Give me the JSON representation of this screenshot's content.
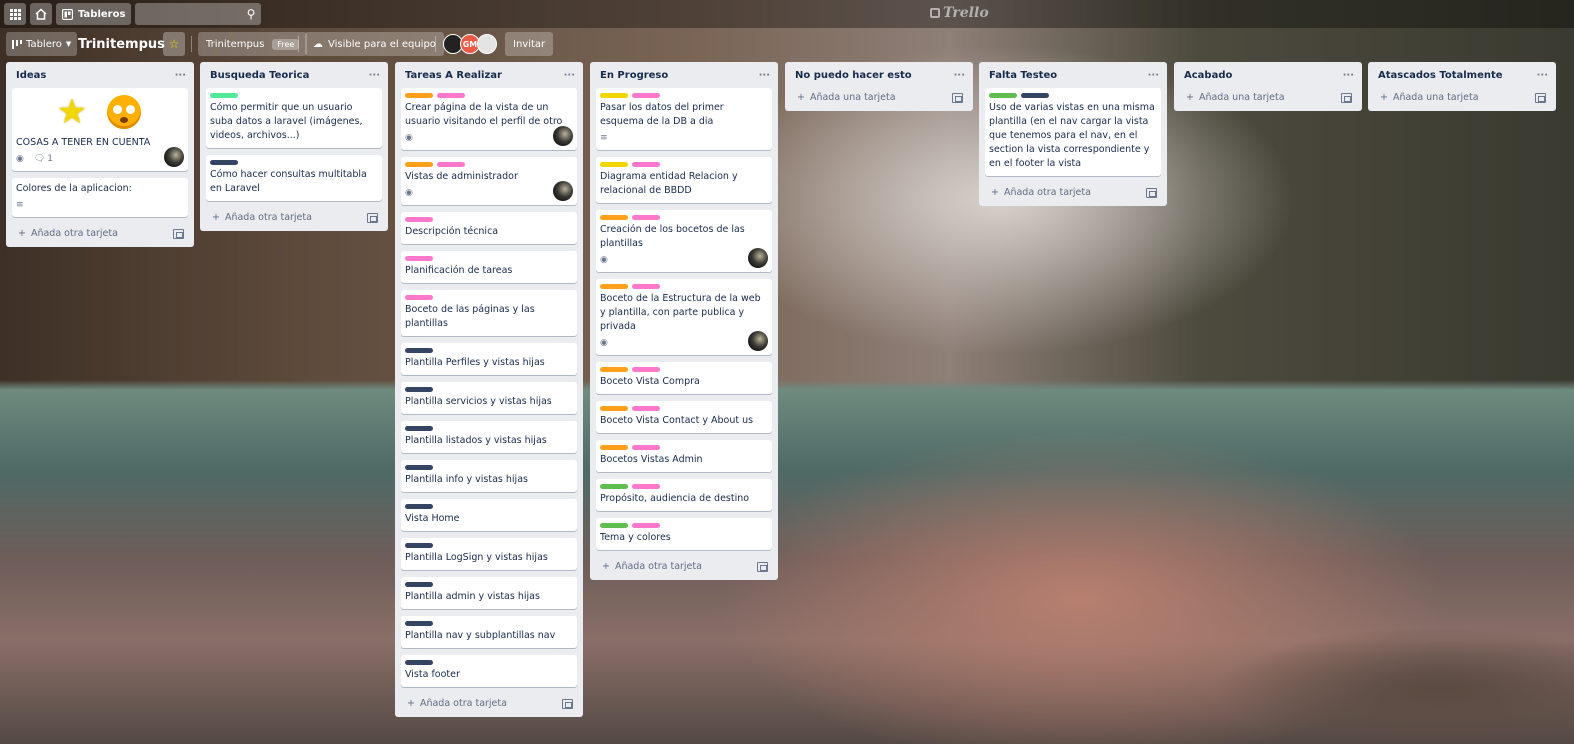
{
  "topbar": {
    "apps_icon": "grid-icon",
    "home_icon": "house-icon",
    "boards_label": "Tableros",
    "search_placeholder": "",
    "logo_text": "Trello"
  },
  "board": {
    "view_label": "Tablero",
    "title": "Trinitempus",
    "team_label": "Trinitempus",
    "team_plan": "Free",
    "visibility_label": "Visible para el equipo",
    "avatar_initials": "GM",
    "invite_label": "Invitar"
  },
  "colors": {
    "green": "#61bd4f",
    "orange": "#ff9f1a",
    "pink": "#ff78cb",
    "navy": "#344563",
    "yellow": "#f2d600",
    "mint": "#51e898"
  },
  "add_card_label": "Añada otra tarjeta",
  "add_card_label_short": "Añada una tarjeta",
  "lists": [
    {
      "title": "Ideas",
      "cards": [
        {
          "text": "COSAS A TENER EN CUENTA",
          "comments": "1"
        },
        {
          "text": "Colores de la aplicacion:"
        }
      ]
    },
    {
      "title": "Busqueda Teorica",
      "cards": [
        {
          "text": "Cómo permitir que un usuario suba datos a laravel (imágenes, videos, archivos...)"
        },
        {
          "text": "Cómo hacer consultas multitabla en Laravel"
        }
      ]
    },
    {
      "title": "Tareas A Realizar",
      "cards": [
        {
          "text": "Crear página de la vista de un usuario visitando el perfil de otro"
        },
        {
          "text": "Vistas de administrador"
        },
        {
          "text": "Descripción técnica"
        },
        {
          "text": "Planificación de tareas"
        },
        {
          "text": "Boceto de las páginas y las plantillas"
        },
        {
          "text": "Plantilla Perfiles y vistas hijas"
        },
        {
          "text": "Plantilla servicios y vistas hijas"
        },
        {
          "text": "Plantilla listados y vistas hijas"
        },
        {
          "text": "Plantilla info y vistas hijas"
        },
        {
          "text": "Vista Home"
        },
        {
          "text": "Plantilla LogSign y vistas hijas"
        },
        {
          "text": "Plantilla admin y vistas hijas"
        },
        {
          "text": "Plantilla nav y subplantillas nav"
        },
        {
          "text": "Vista footer"
        }
      ]
    },
    {
      "title": "En Progreso",
      "cards": [
        {
          "text": "Pasar los datos del primer esquema de la DB a dia"
        },
        {
          "text": "Diagrama entidad Relacion y relacional de BBDD"
        },
        {
          "text": "Creación de los bocetos de las plantillas"
        },
        {
          "text": "Boceto de la Estructura de la web y plantilla, con parte publica y privada"
        },
        {
          "text": "Boceto Vista Compra"
        },
        {
          "text": "Boceto Vista Contact y About us"
        },
        {
          "text": "Bocetos Vistas Admin"
        },
        {
          "text": "Propósito, audiencia de destino"
        },
        {
          "text": "Tema y colores"
        }
      ]
    },
    {
      "title": "No puedo hacer esto",
      "cards": []
    },
    {
      "title": "Falta Testeo",
      "cards": [
        {
          "text": "Uso de varias vistas en una misma plantilla (en el nav cargar la vista que tenemos para el nav, en el section la vista correspondiente y en el footer la vista"
        }
      ]
    },
    {
      "title": "Acabado",
      "cards": []
    },
    {
      "title": "Atascados Totalmente",
      "cards": []
    }
  ]
}
